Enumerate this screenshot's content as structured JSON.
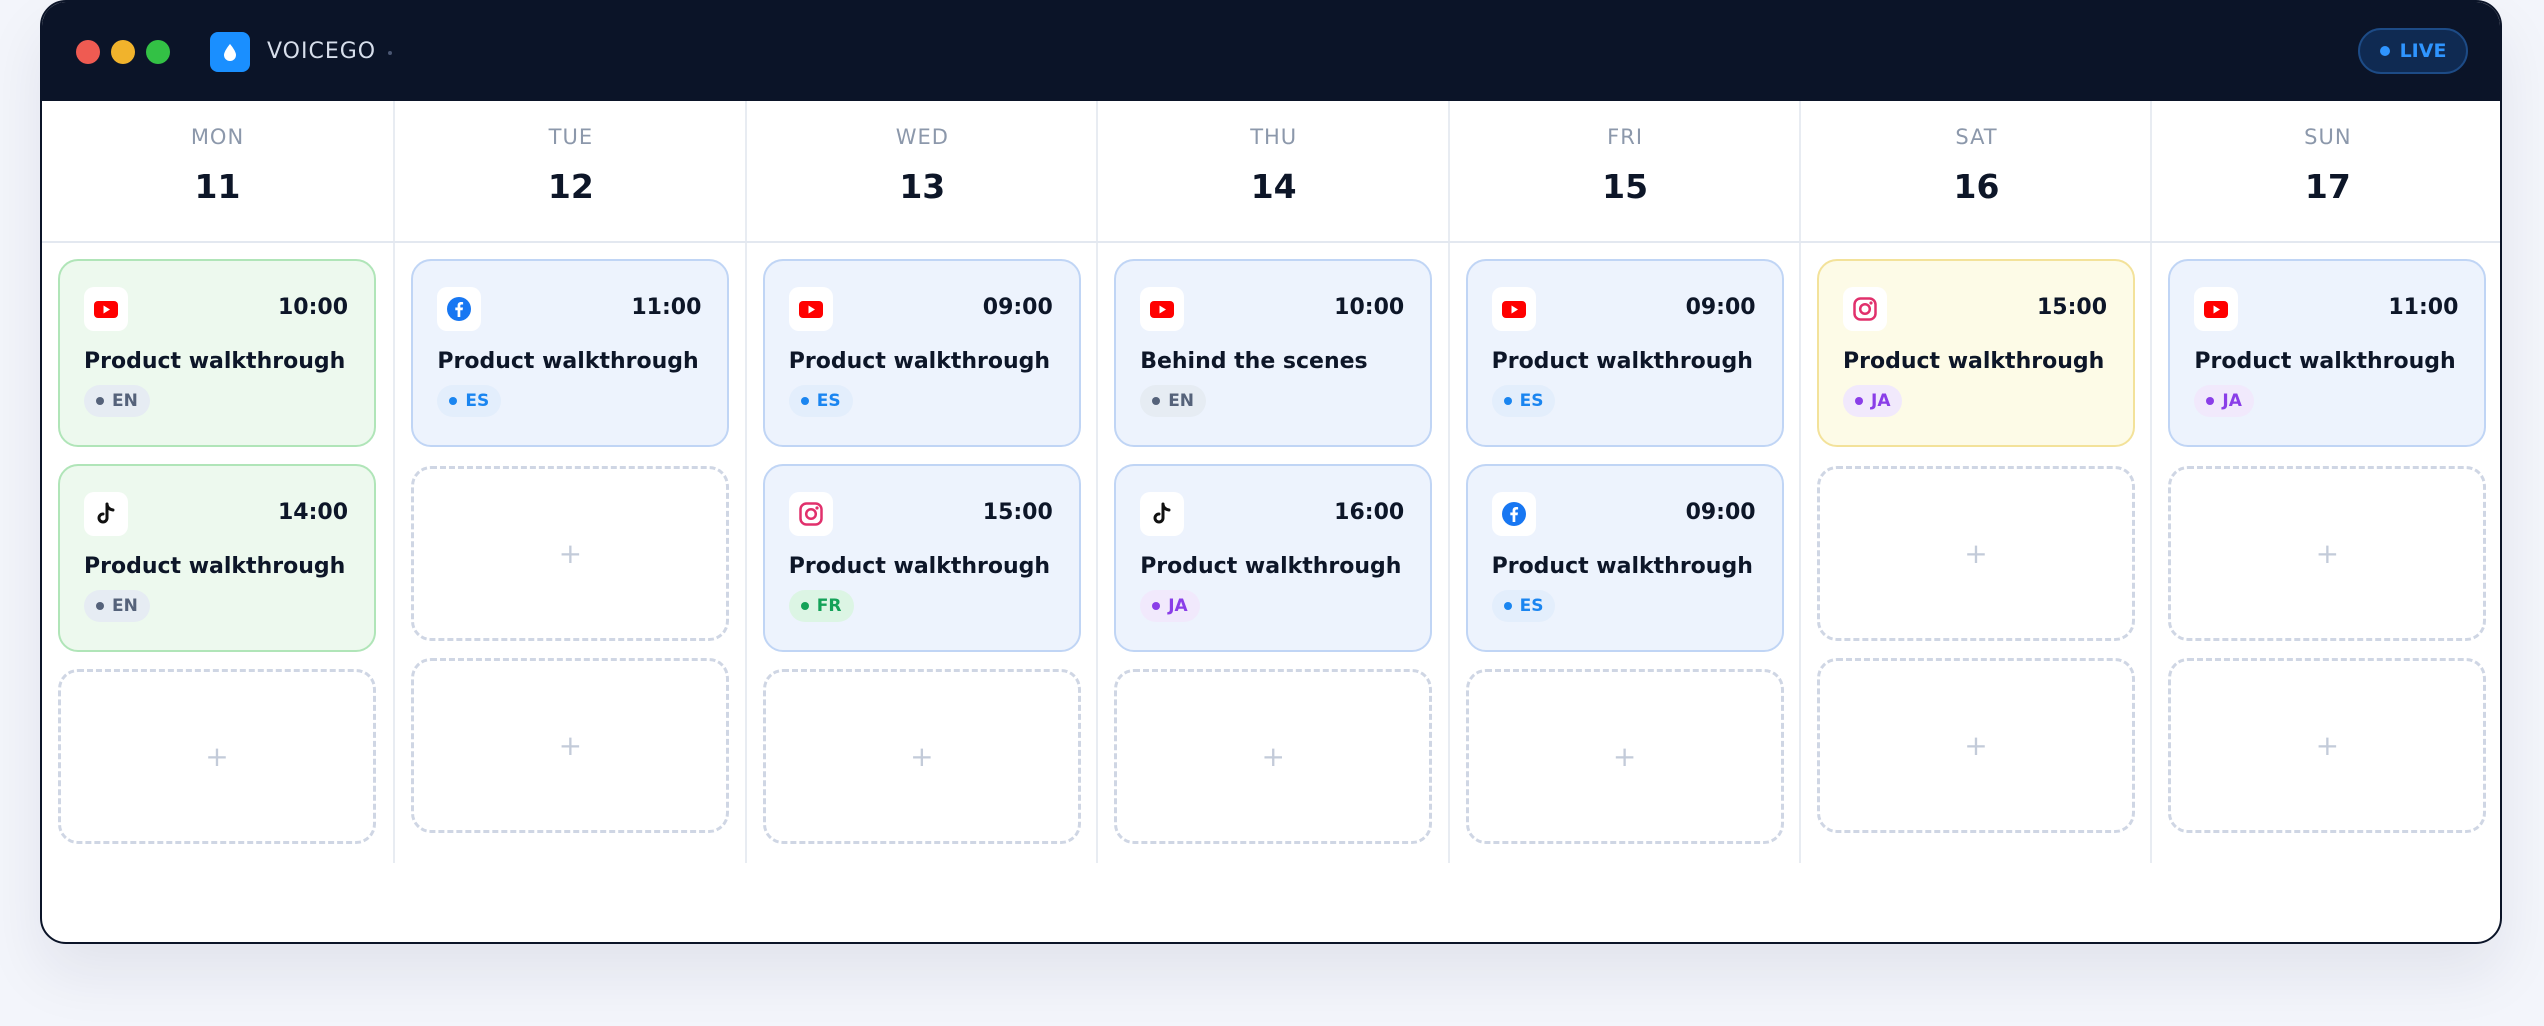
{
  "app": {
    "name": "VOICEGO",
    "status": "LIVE"
  },
  "days": [
    {
      "name": "MON",
      "date": "11",
      "cards": [
        {
          "platform": "youtube",
          "time": "10:00",
          "title": "Product walkthrough",
          "lang": "EN",
          "theme": "green"
        },
        {
          "platform": "tiktok",
          "time": "14:00",
          "title": "Product walkthrough",
          "lang": "EN",
          "theme": "green"
        }
      ],
      "empty_slots": 1
    },
    {
      "name": "TUE",
      "date": "12",
      "cards": [
        {
          "platform": "facebook",
          "time": "11:00",
          "title": "Product walkthrough",
          "lang": "ES",
          "theme": "blue"
        }
      ],
      "empty_slots": 2
    },
    {
      "name": "WED",
      "date": "13",
      "cards": [
        {
          "platform": "youtube",
          "time": "09:00",
          "title": "Product walkthrough",
          "lang": "ES",
          "theme": "blue"
        },
        {
          "platform": "instagram",
          "time": "15:00",
          "title": "Product walkthrough",
          "lang": "FR",
          "theme": "blue"
        }
      ],
      "empty_slots": 1
    },
    {
      "name": "THU",
      "date": "14",
      "cards": [
        {
          "platform": "youtube",
          "time": "10:00",
          "title": "Behind the scenes",
          "lang": "EN",
          "theme": "blue"
        },
        {
          "platform": "tiktok",
          "time": "16:00",
          "title": "Product walkthrough",
          "lang": "JA",
          "theme": "blue"
        }
      ],
      "empty_slots": 1
    },
    {
      "name": "FRI",
      "date": "15",
      "cards": [
        {
          "platform": "youtube",
          "time": "09:00",
          "title": "Product walkthrough",
          "lang": "ES",
          "theme": "blue"
        },
        {
          "platform": "facebook",
          "time": "09:00",
          "title": "Product walkthrough",
          "lang": "ES",
          "theme": "blue"
        }
      ],
      "empty_slots": 1
    },
    {
      "name": "SAT",
      "date": "16",
      "cards": [
        {
          "platform": "instagram",
          "time": "15:00",
          "title": "Product walkthrough",
          "lang": "JA",
          "theme": "yellow"
        }
      ],
      "empty_slots": 2
    },
    {
      "name": "SUN",
      "date": "17",
      "cards": [
        {
          "platform": "youtube",
          "time": "11:00",
          "title": "Product walkthrough",
          "lang": "JA",
          "theme": "blue"
        }
      ],
      "empty_slots": 2
    }
  ],
  "add_label": "+",
  "colors": {
    "titlebar": "#0b1428",
    "accent": "#1a8fff"
  }
}
